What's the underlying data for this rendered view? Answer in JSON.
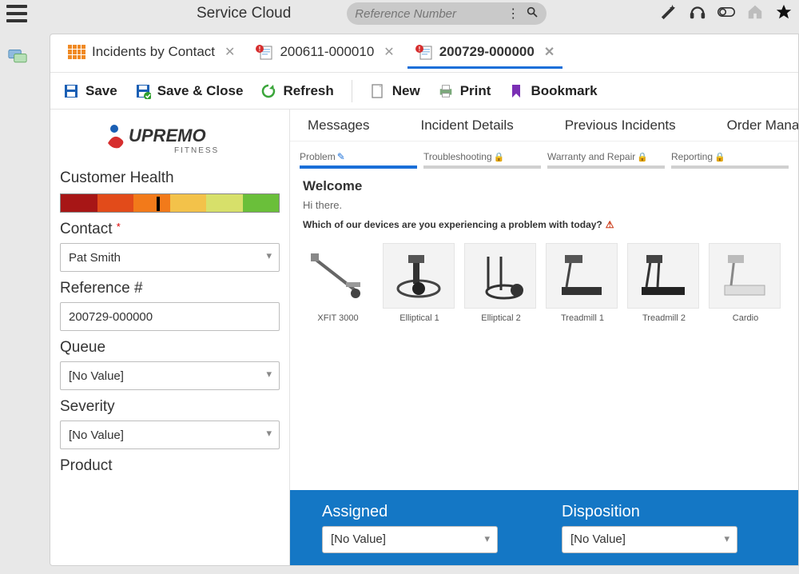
{
  "app": {
    "title": "Service Cloud"
  },
  "search": {
    "placeholder": "Reference Number"
  },
  "tabs": [
    {
      "label": "Incidents by Contact",
      "icon": "grid",
      "active": false
    },
    {
      "label": "200611-000010",
      "icon": "incident",
      "active": false
    },
    {
      "label": "200729-000000",
      "icon": "incident",
      "active": true
    }
  ],
  "toolbar": {
    "save": "Save",
    "save_close": "Save & Close",
    "refresh": "Refresh",
    "new": "New",
    "print": "Print",
    "bookmark": "Bookmark"
  },
  "brand": {
    "name": "UPREMO",
    "sub": "FITNESS"
  },
  "left": {
    "health_label": "Customer Health",
    "contact_label": "Contact",
    "contact_value": "Pat Smith",
    "ref_label": "Reference #",
    "ref_value": "200729-000000",
    "queue_label": "Queue",
    "queue_value": "[No Value]",
    "severity_label": "Severity",
    "severity_value": "[No Value]",
    "product_label": "Product"
  },
  "subtabs": [
    "Messages",
    "Incident Details",
    "Previous Incidents",
    "Order Manag"
  ],
  "wizard": [
    {
      "label": "Problem",
      "state": "active"
    },
    {
      "label": "Troubleshooting",
      "state": "locked"
    },
    {
      "label": "Warranty and Repair",
      "state": "locked"
    },
    {
      "label": "Reporting",
      "state": "locked"
    }
  ],
  "guide": {
    "heading": "Welcome",
    "greeting": "Hi there.",
    "question": "Which of our devices are you experiencing a problem with today?"
  },
  "devices": [
    {
      "label": "XFIT 3000"
    },
    {
      "label": "Elliptical 1"
    },
    {
      "label": "Elliptical 2"
    },
    {
      "label": "Treadmill 1"
    },
    {
      "label": "Treadmill 2"
    },
    {
      "label": "Cardio"
    }
  ],
  "bluebar": {
    "assigned_label": "Assigned",
    "assigned_value": "[No Value]",
    "disposition_label": "Disposition",
    "disposition_value": "[No Value]"
  }
}
